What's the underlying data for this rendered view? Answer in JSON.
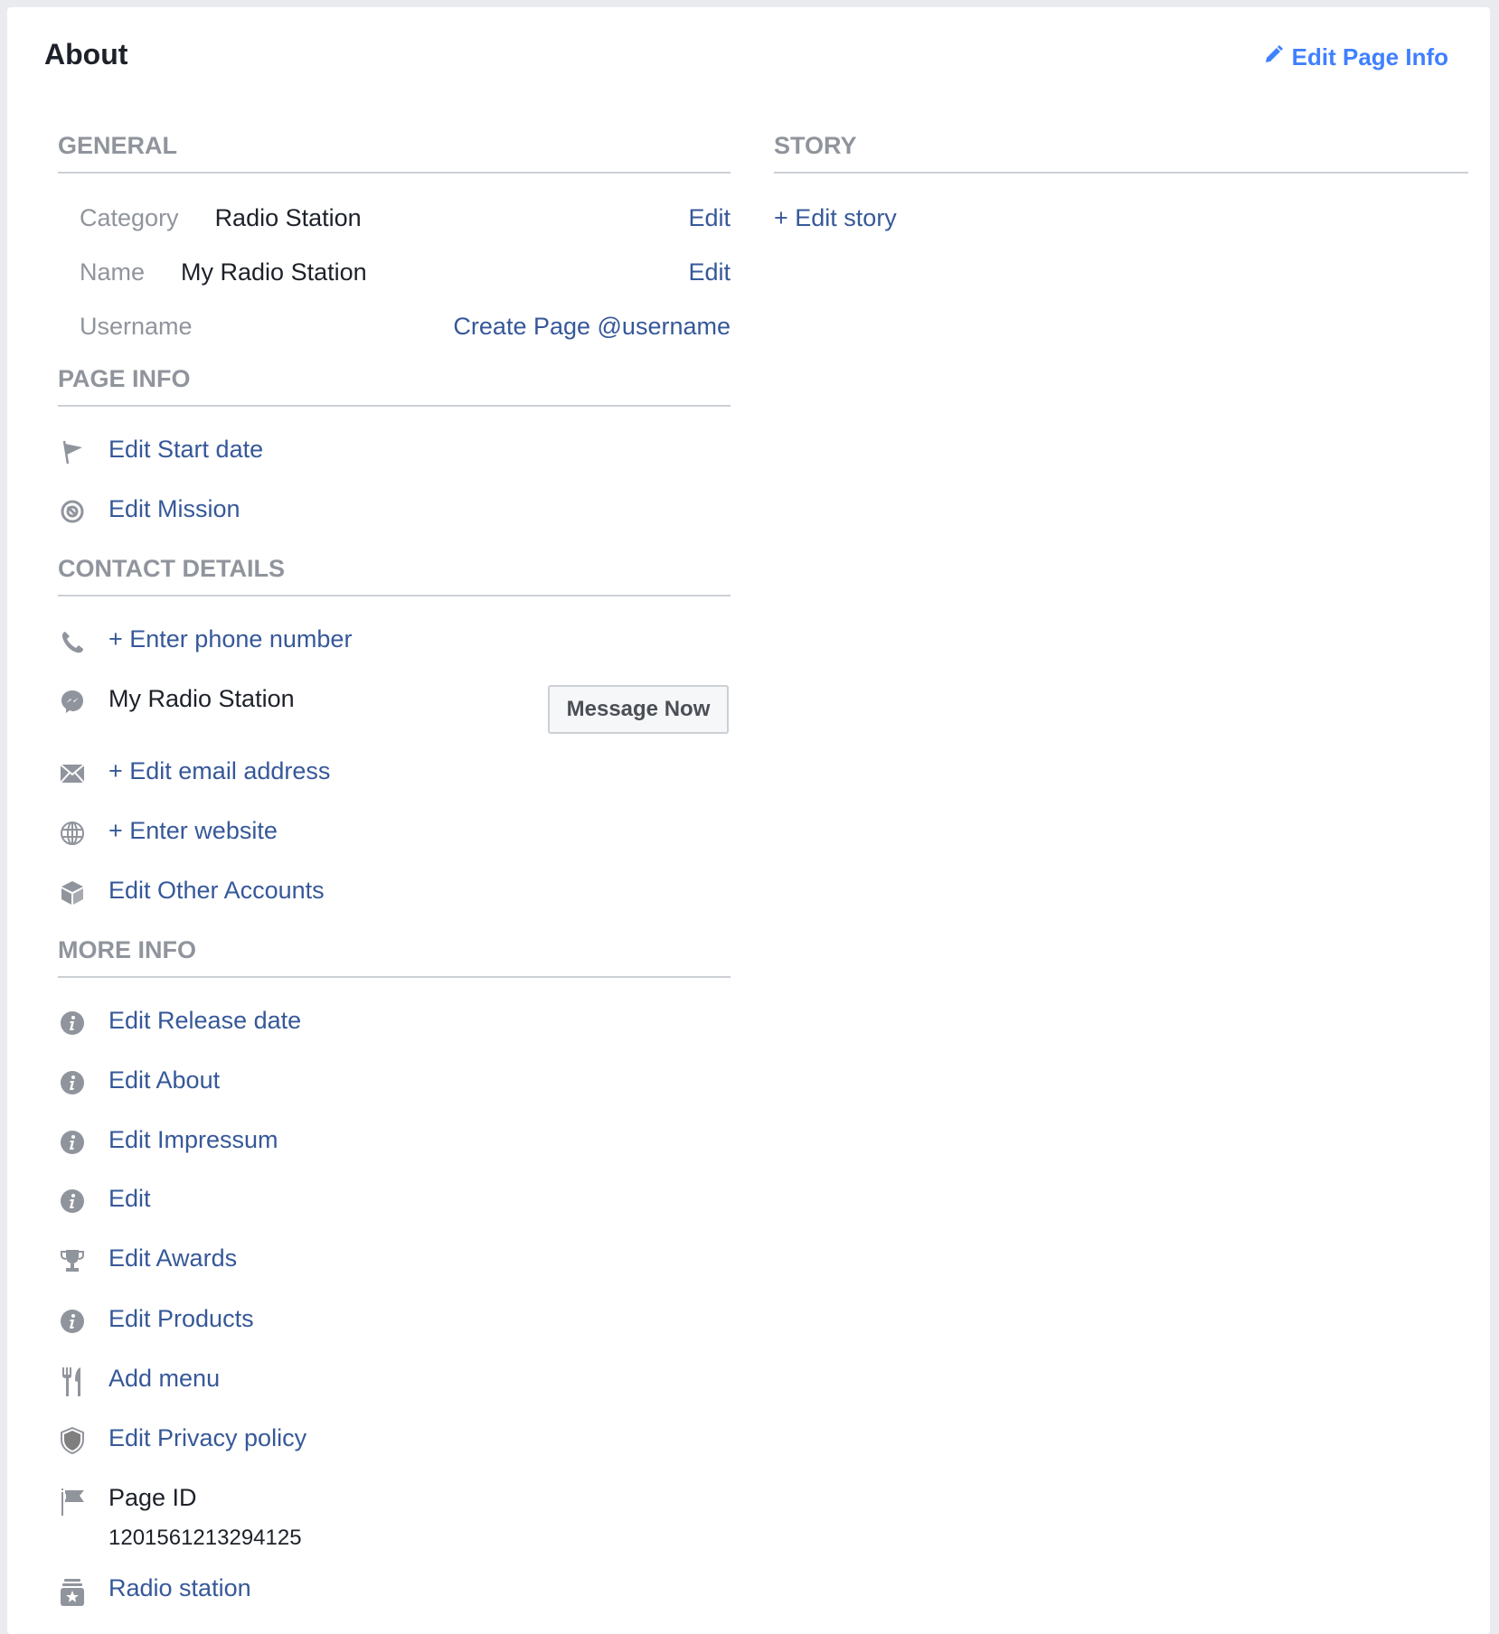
{
  "header": {
    "title": "About",
    "edit_page_info": "Edit Page Info"
  },
  "general": {
    "heading": "GENERAL",
    "rows": [
      {
        "label": "Category",
        "value": "Radio Station",
        "action": "Edit"
      },
      {
        "label": "Name",
        "value": "My Radio Station",
        "action": "Edit"
      },
      {
        "label": "Username",
        "action": "Create Page @username"
      }
    ]
  },
  "page_info": {
    "heading": "PAGE INFO",
    "items": [
      {
        "icon": "flag-icon",
        "label": "Edit Start date"
      },
      {
        "icon": "target-icon",
        "label": "Edit Mission"
      }
    ]
  },
  "contact": {
    "heading": "CONTACT DETAILS",
    "phone": "+ Enter phone number",
    "messenger_name": "My Radio Station",
    "message_button": "Message Now",
    "email": "+ Edit email address",
    "website": "+ Enter website",
    "other_accounts": "Edit Other Accounts"
  },
  "more_info": {
    "heading": "MORE INFO",
    "items": [
      {
        "icon": "info-icon",
        "label": "Edit Release date"
      },
      {
        "icon": "info-icon",
        "label": "Edit About"
      },
      {
        "icon": "info-icon",
        "label": "Edit Impressum"
      },
      {
        "icon": "info-icon",
        "label": "Edit"
      },
      {
        "icon": "trophy-icon",
        "label": "Edit Awards"
      },
      {
        "icon": "info-icon",
        "label": "Edit Products"
      },
      {
        "icon": "fork-knife-icon",
        "label": "Add menu"
      },
      {
        "icon": "shield-icon",
        "label": "Edit Privacy policy"
      }
    ],
    "page_id_label": "Page ID",
    "page_id_value": "1201561213294125",
    "category_link": "Radio station"
  },
  "story": {
    "heading": "STORY",
    "edit": "+ Edit story"
  },
  "colors": {
    "link": "#365899",
    "accent": "#4080ff",
    "muted": "#90949c",
    "text": "#1d2129"
  }
}
